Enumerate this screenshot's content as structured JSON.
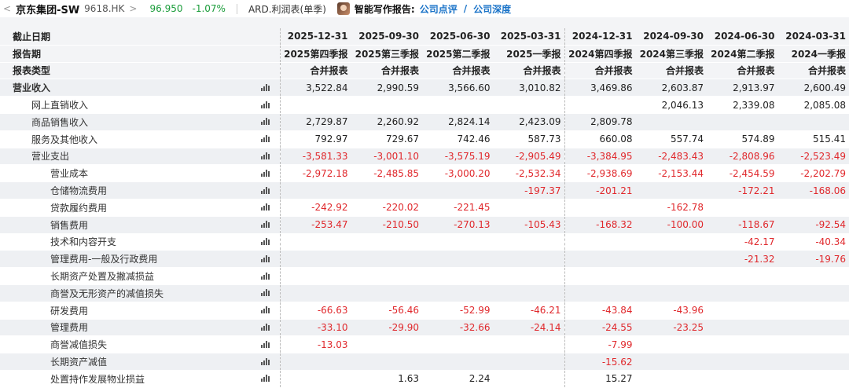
{
  "topbar": {
    "back_chevron": "<",
    "stock_name": "京东集团-SW",
    "stock_code": "9618.HK",
    "forward_chevron": ">",
    "price": "96.950",
    "change": "-1.07%",
    "report_name": "ARD.利润表(单季)",
    "ai_label": "智能写作报告:",
    "link_review": "公司点评",
    "link_depth": "公司深度",
    "link_separator": "/"
  },
  "header_rows": [
    {
      "label": "截止日期",
      "values": [
        "2025-12-31",
        "2025-09-30",
        "2025-06-30",
        "2025-03-31",
        "2024-12-31",
        "2024-09-30",
        "2024-06-30",
        "2024-03-31"
      ]
    },
    {
      "label": "报告期",
      "values": [
        "2025第四季报",
        "2025第三季报",
        "2025第二季报",
        "2025一季报",
        "2024第四季报",
        "2024第三季报",
        "2024第二季报",
        "2024一季报"
      ]
    },
    {
      "label": "报表类型",
      "values": [
        "合并报表",
        "合并报表",
        "合并报表",
        "合并报表",
        "合并报表",
        "合并报表",
        "合并报表",
        "合并报表"
      ]
    }
  ],
  "rows": [
    {
      "label": "营业收入",
      "level": 0,
      "values": [
        "3,522.84",
        "2,990.59",
        "3,566.60",
        "3,010.82",
        "3,469.86",
        "2,603.87",
        "2,913.97",
        "2,600.49"
      ]
    },
    {
      "label": "网上直销收入",
      "level": 1,
      "values": [
        "",
        "",
        "",
        "",
        "",
        "2,046.13",
        "2,339.08",
        "2,085.08"
      ]
    },
    {
      "label": "商品销售收入",
      "level": 1,
      "values": [
        "2,729.87",
        "2,260.92",
        "2,824.14",
        "2,423.09",
        "2,809.78",
        "",
        "",
        ""
      ]
    },
    {
      "label": "服务及其他收入",
      "level": 1,
      "values": [
        "792.97",
        "729.67",
        "742.46",
        "587.73",
        "660.08",
        "557.74",
        "574.89",
        "515.41"
      ]
    },
    {
      "label": "营业支出",
      "level": 1,
      "values": [
        "-3,581.33",
        "-3,001.10",
        "-3,575.19",
        "-2,905.49",
        "-3,384.95",
        "-2,483.43",
        "-2,808.96",
        "-2,523.49"
      ]
    },
    {
      "label": "营业成本",
      "level": 2,
      "values": [
        "-2,972.18",
        "-2,485.85",
        "-3,000.20",
        "-2,532.34",
        "-2,938.69",
        "-2,153.44",
        "-2,454.59",
        "-2,202.79"
      ]
    },
    {
      "label": "仓储物流费用",
      "level": 2,
      "values": [
        "",
        "",
        "",
        "-197.37",
        "-201.21",
        "",
        "-172.21",
        "-168.06"
      ]
    },
    {
      "label": "贷款履约费用",
      "level": 2,
      "values": [
        "-242.92",
        "-220.02",
        "-221.45",
        "",
        "",
        "-162.78",
        "",
        ""
      ]
    },
    {
      "label": "销售费用",
      "level": 2,
      "values": [
        "-253.47",
        "-210.50",
        "-270.13",
        "-105.43",
        "-168.32",
        "-100.00",
        "-118.67",
        "-92.54"
      ]
    },
    {
      "label": "技术和内容开支",
      "level": 2,
      "values": [
        "",
        "",
        "",
        "",
        "",
        "",
        "-42.17",
        "-40.34"
      ]
    },
    {
      "label": "管理费用-一般及行政费用",
      "level": 2,
      "values": [
        "",
        "",
        "",
        "",
        "",
        "",
        "-21.32",
        "-19.76"
      ]
    },
    {
      "label": "长期资产处置及撇减损益",
      "level": 2,
      "values": [
        "",
        "",
        "",
        "",
        "",
        "",
        "",
        ""
      ]
    },
    {
      "label": "商誉及无形资产的减值损失",
      "level": 2,
      "values": [
        "",
        "",
        "",
        "",
        "",
        "",
        "",
        ""
      ]
    },
    {
      "label": "研发费用",
      "level": 2,
      "values": [
        "-66.63",
        "-56.46",
        "-52.99",
        "-46.21",
        "-43.84",
        "-43.96",
        "",
        ""
      ]
    },
    {
      "label": "管理费用",
      "level": 2,
      "values": [
        "-33.10",
        "-29.90",
        "-32.66",
        "-24.14",
        "-24.55",
        "-23.25",
        "",
        ""
      ]
    },
    {
      "label": "商誉减值损失",
      "level": 2,
      "values": [
        "-13.03",
        "",
        "",
        "",
        "-7.99",
        "",
        "",
        ""
      ]
    },
    {
      "label": "长期资产减值",
      "level": 2,
      "values": [
        "",
        "",
        "",
        "",
        "-15.62",
        "",
        "",
        ""
      ]
    },
    {
      "label": "处置持作发展物业损益",
      "level": 2,
      "values": [
        "",
        "1.63",
        "2.24",
        "",
        "15.27",
        "",
        "",
        ""
      ]
    }
  ],
  "chart_icon": "bar-chart-icon",
  "colors": {
    "up": "#e0282c",
    "down": "#1a9c3a",
    "link": "#1a73c8"
  }
}
